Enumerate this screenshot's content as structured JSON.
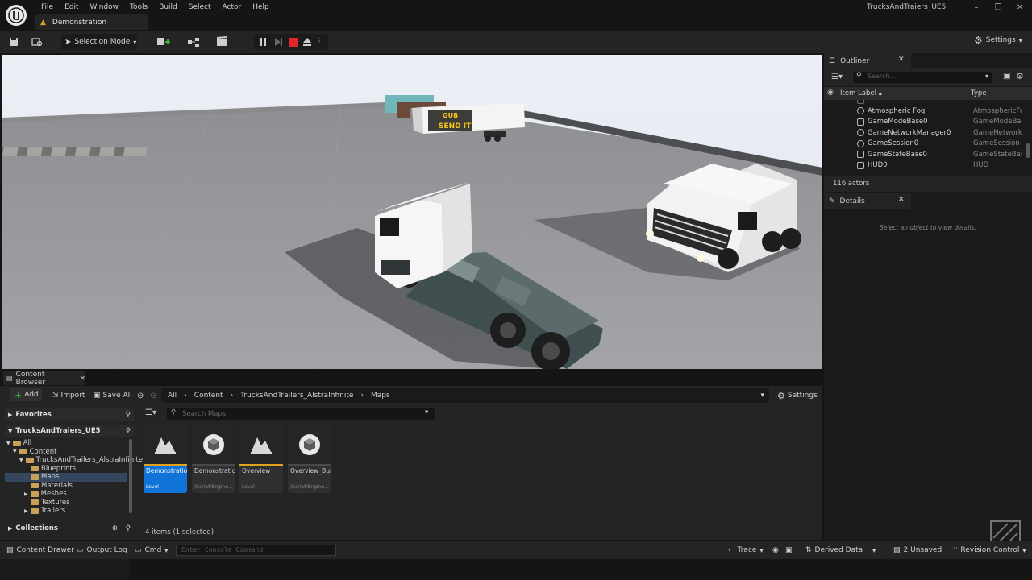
{
  "menu": [
    "File",
    "Edit",
    "Window",
    "Tools",
    "Build",
    "Select",
    "Actor",
    "Help"
  ],
  "level_tab": "Demonstration",
  "app_title": "TrucksAndTraiers_UE5",
  "toolbar": {
    "selection_mode": "Selection Mode",
    "settings": "Settings"
  },
  "viewport": {
    "trailer_text": "SEND IT",
    "trailer_logo": "GUB"
  },
  "outliner": {
    "title": "Outliner",
    "search_placeholder": "Search...",
    "col_label": "Item Label ▴",
    "col_type": "Type",
    "rows": [
      {
        "name": "Atmospheric Fog",
        "type": "AtmosphericFog"
      },
      {
        "name": "GameModeBase0",
        "type": "GameModeBase"
      },
      {
        "name": "GameNetworkManager0",
        "type": "GameNetworkM"
      },
      {
        "name": "GameSession0",
        "type": "GameSession"
      },
      {
        "name": "GameStateBase0",
        "type": "GameStateBase"
      },
      {
        "name": "HUD0",
        "type": "HUD"
      }
    ],
    "actor_count": "116 actors"
  },
  "details": {
    "title": "Details",
    "empty_msg": "Select an object to view details."
  },
  "content_browser": {
    "tab": "Content Browser",
    "add": "Add",
    "import": "Import",
    "save_all": "Save All",
    "path": [
      "All",
      "Content",
      "TrucksAndTrailers_AlstraInfinite",
      "Maps"
    ],
    "settings": "Settings",
    "favorites": "Favorites",
    "project": "TrucksAndTraiers_UE5",
    "tree": [
      "All",
      "Content",
      "TrucksAndTrailers_AlstraInfinite",
      "Blueprints",
      "Maps",
      "Materials",
      "Meshes",
      "Textures",
      "Trailers"
    ],
    "collections": "Collections",
    "search_placeholder": "Search Maps",
    "assets": [
      {
        "name": "Demonstration",
        "cls": "Level"
      },
      {
        "name": "Demonstration_BuiltData",
        "cls": "/Script/Engine..."
      },
      {
        "name": "Overview",
        "cls": "Level"
      },
      {
        "name": "Overview_BuiltData",
        "cls": "/Script/Engine..."
      }
    ],
    "item_count": "4 items (1 selected)"
  },
  "statusbar": {
    "content_drawer": "Content Drawer",
    "output_log": "Output Log",
    "cmd": "Cmd",
    "console_placeholder": "Enter Console Command",
    "trace": "Trace",
    "derived_data": "Derived Data",
    "unsaved": "2 Unsaved",
    "revision_control": "Revision Control"
  },
  "colors": {
    "accent": "#0f73d8",
    "folder": "#c8a05a",
    "level_underline": "#e0a020"
  }
}
